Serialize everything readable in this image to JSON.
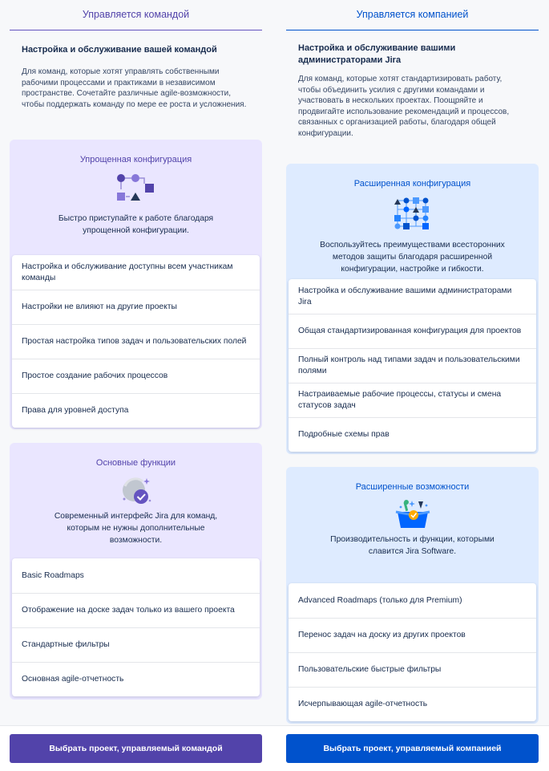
{
  "team": {
    "header": "Управляется командой",
    "intro_title": "Настройка и обслуживание вашей командой",
    "intro_text": "Для команд, которые хотят управлять собственными рабочими процессами и практиками в независимом пространстве. Сочетайте различные agile-возможности, чтобы поддержать команду по мере ее роста и усложнения.",
    "config": {
      "title": "Упрощенная конфигурация",
      "icon": "simple-config-icon",
      "description": "Быстро приступайте к работе благодаря упрощенной конфигурации.",
      "items": [
        "Настройка и обслуживание доступны всем участникам команды",
        "Настройки не влияют на другие проекты",
        "Простая настройка типов задач и пользовательских полей",
        "Простое создание рабочих процессов",
        "Права для уровней доступа"
      ]
    },
    "features": {
      "title": "Основные функции",
      "icon": "basic-features-icon",
      "description": "Современный интерфейс Jira для команд, которым не нужны дополнительные возможности.",
      "items": [
        "Basic Roadmaps",
        "Отображение на доске задач только из вашего проекта",
        "Стандартные фильтры",
        "Основная agile-отчетность"
      ]
    },
    "button": "Выбрать проект, управляемый командой"
  },
  "company": {
    "header": "Управляется компанией",
    "intro_title": "Настройка и обслуживание вашими администраторами Jira",
    "intro_text": "Для команд, которые хотят стандартизировать работу, чтобы объединить усилия с другими командами и участвовать в нескольких проектах. Поощряйте и продвигайте использование рекомендаций и процессов, связанных с организацией работы, благодаря общей конфигурации.",
    "config": {
      "title": "Расширенная конфигурация",
      "icon": "advanced-config-icon",
      "description": "Воспользуйтесь преимуществами всесторонних методов защиты благодаря расширенной конфигурации, настройке и гибкости.",
      "items": [
        "Настройка и обслуживание вашими администраторами Jira",
        "Общая стандартизированная конфигурация для проектов",
        "Полный контроль над типами задач и пользовательскими полями",
        "Настраиваемые рабочие процессы, статусы и смена статусов задач",
        "Подробные схемы прав"
      ]
    },
    "features": {
      "title": "Расширенные возможности",
      "icon": "advanced-features-icon",
      "description": "Производительность и функции, которыми славится Jira Software.",
      "items": [
        "Advanced Roadmaps (только для Premium)",
        "Перенос задач на доску из других проектов",
        "Пользовательские быстрые фильтры",
        "Исчерпывающая agile-отчетность"
      ]
    },
    "button": "Выбрать проект, управляемый компанией"
  },
  "colors": {
    "team_accent": "#5243aa",
    "company_accent": "#0052cc",
    "team_card_bg": "#eae6ff",
    "company_card_bg": "#deebff"
  }
}
